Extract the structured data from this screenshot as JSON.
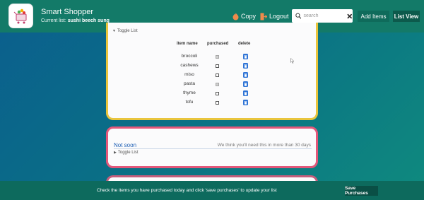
{
  "header": {
    "app_title": "Smart Shopper",
    "current_list_label": "Current list:",
    "current_list_value": "sushi beech sung",
    "copy_label": "Copy",
    "logout_label": "Logout",
    "search_placeholder": "search",
    "add_items_label": "Add Items",
    "list_view_label": "List View"
  },
  "soon_card": {
    "toggle_label": "Toggle List",
    "columns": [
      "item name",
      "purchased",
      "delete"
    ],
    "items": [
      {
        "name": "broccoli",
        "purchased": true
      },
      {
        "name": "cashews",
        "purchased": false
      },
      {
        "name": "miso",
        "purchased": false
      },
      {
        "name": "pasta",
        "purchased": true
      },
      {
        "name": "thyme",
        "purchased": false
      },
      {
        "name": "tofu",
        "purchased": false
      }
    ]
  },
  "not_soon_card": {
    "title": "Not soon",
    "description": "We think you'll need this in more than 30 days",
    "toggle_label": "Toggle List"
  },
  "footer": {
    "message": "Check the items you have purchased today and click 'save purchases' to update your list",
    "save_label": "Save Purchases"
  },
  "colors": {
    "header_bg": "#137a68",
    "footer_bg": "#0d6a5d",
    "soon_border": "#e9c53d",
    "not_soon_border": "#e3577a",
    "delete_button": "#2f74d6",
    "section_title": "#1d5fb5"
  }
}
